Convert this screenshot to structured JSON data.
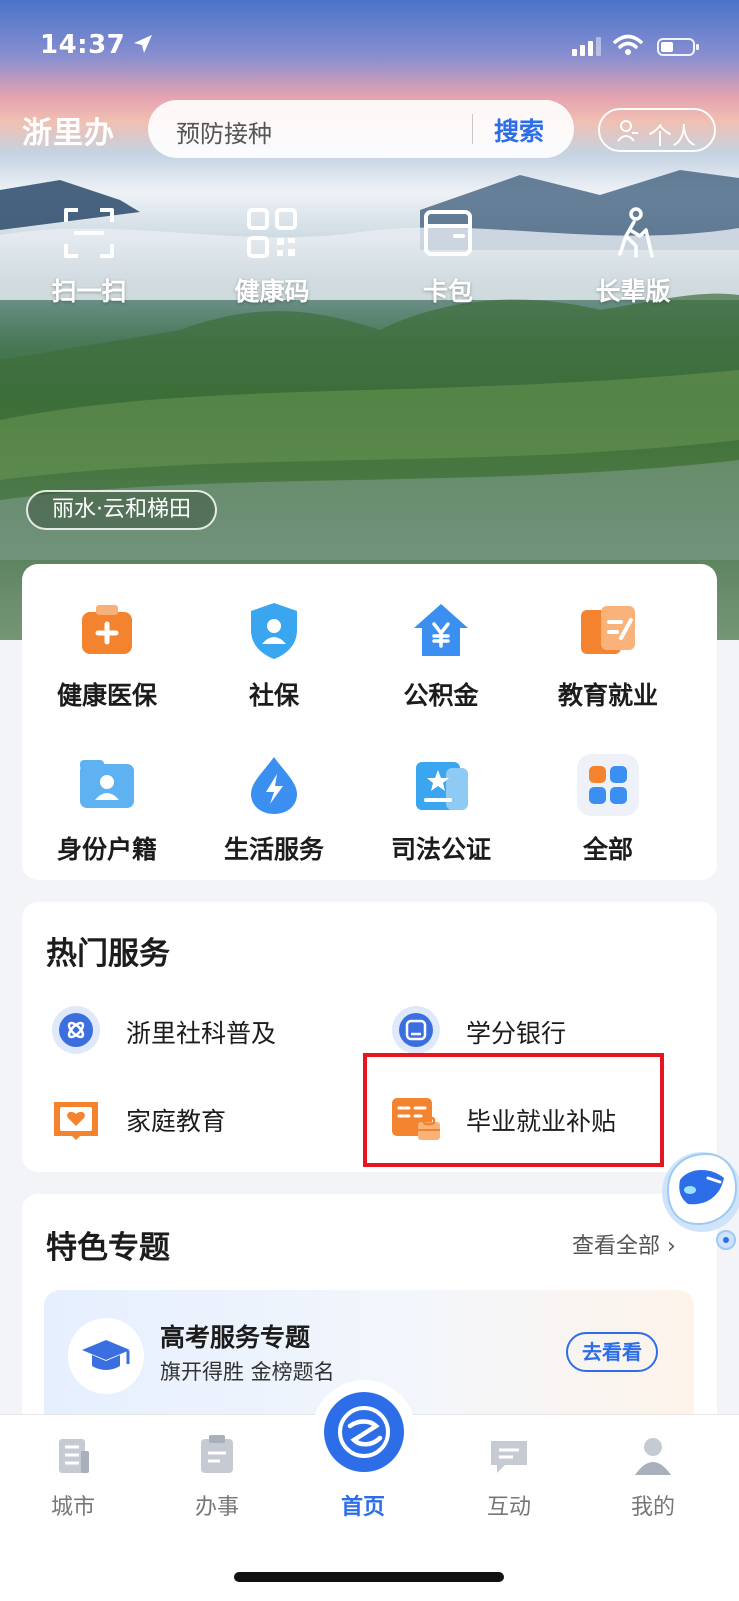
{
  "status_bar": {
    "time": "14:37"
  },
  "header": {
    "logo": "浙里办",
    "search_placeholder": "预防接种",
    "search_button": "搜索",
    "personal_label": "个人"
  },
  "quick_actions": [
    {
      "label": "扫一扫",
      "icon": "scan-icon"
    },
    {
      "label": "健康码",
      "icon": "qr-code-icon"
    },
    {
      "label": "卡包",
      "icon": "card-wallet-icon"
    },
    {
      "label": "长辈版",
      "icon": "elder-icon"
    }
  ],
  "location_tag": "丽水·云和梯田",
  "services": [
    {
      "label": "健康医保",
      "icon": "medical-kit-icon"
    },
    {
      "label": "社保",
      "icon": "shield-person-icon"
    },
    {
      "label": "公积金",
      "icon": "house-yuan-icon"
    },
    {
      "label": "教育就业",
      "icon": "education-icon"
    },
    {
      "label": "身份户籍",
      "icon": "id-folder-icon"
    },
    {
      "label": "生活服务",
      "icon": "lightning-drop-icon"
    },
    {
      "label": "司法公证",
      "icon": "justice-folder-icon"
    },
    {
      "label": "全部",
      "icon": "grid-all-icon"
    }
  ],
  "hot_services": {
    "title": "热门服务",
    "items": [
      {
        "label": "浙里社科普及",
        "icon": "science-icon"
      },
      {
        "label": "学分银行",
        "icon": "credit-bank-icon"
      },
      {
        "label": "家庭教育",
        "icon": "family-book-icon"
      },
      {
        "label": "毕业就业补贴",
        "icon": "employment-subsidy-icon"
      }
    ]
  },
  "featured": {
    "title": "特色专题",
    "view_all": "查看全部",
    "banner_title": "高考服务专题",
    "banner_subtitle": "旗开得胜 金榜题名",
    "banner_button": "去看看"
  },
  "tab_bar": [
    {
      "label": "城市",
      "icon": "city-icon"
    },
    {
      "label": "办事",
      "icon": "affairs-icon"
    },
    {
      "label": "首页",
      "icon": "home-logo-icon"
    },
    {
      "label": "互动",
      "icon": "interact-icon"
    },
    {
      "label": "我的",
      "icon": "profile-icon"
    }
  ],
  "colors": {
    "accent": "#2d6ee8",
    "highlight_box": "#e8161c",
    "orange": "#f08a3c"
  }
}
